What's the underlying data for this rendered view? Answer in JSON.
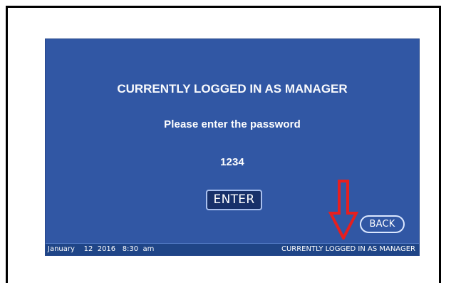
{
  "screen": {
    "title": "CURRENTLY LOGGED IN AS MANAGER",
    "prompt": "Please enter the password",
    "password_value": "1234"
  },
  "buttons": {
    "enter_label": "ENTER",
    "back_label": "BACK"
  },
  "status_bar": {
    "date_time": "January    12  2016   8:30  am",
    "login_status": "CURRENTLY LOGGED IN AS MANAGER"
  },
  "annotation": {
    "icon": "down-arrow-icon",
    "color": "#e61f1f"
  },
  "colors": {
    "screen_background": "#3157a4",
    "enter_button_background": "#18316a",
    "text": "#ffffff"
  }
}
